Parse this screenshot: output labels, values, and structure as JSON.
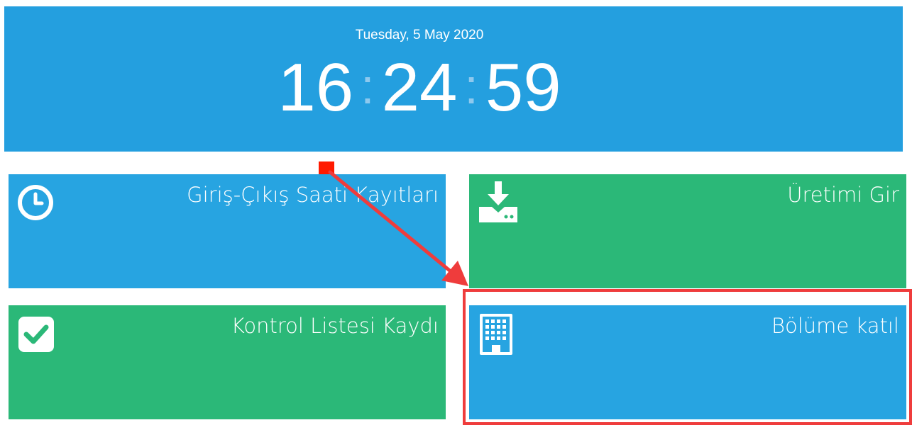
{
  "clock": {
    "date": "Tuesday, 5 May 2020",
    "hours": "16",
    "minutes": "24",
    "seconds": "59",
    "separator": ":"
  },
  "tiles": [
    {
      "label": "Giriş-Çıkış Saati Kayıtları",
      "icon": "clock-icon",
      "color": "#27a4e1"
    },
    {
      "label": "Üretimi Gir",
      "icon": "download-icon",
      "color": "#2bb878"
    },
    {
      "label": "Kontrol Listesi Kaydı",
      "icon": "checkbox-icon",
      "color": "#2bb878"
    },
    {
      "label": "Bölüme katıl",
      "icon": "building-icon",
      "color": "#27a4e1"
    }
  ],
  "colors": {
    "header_bg": "#249fdf",
    "annotation": "#ef3c3c"
  }
}
